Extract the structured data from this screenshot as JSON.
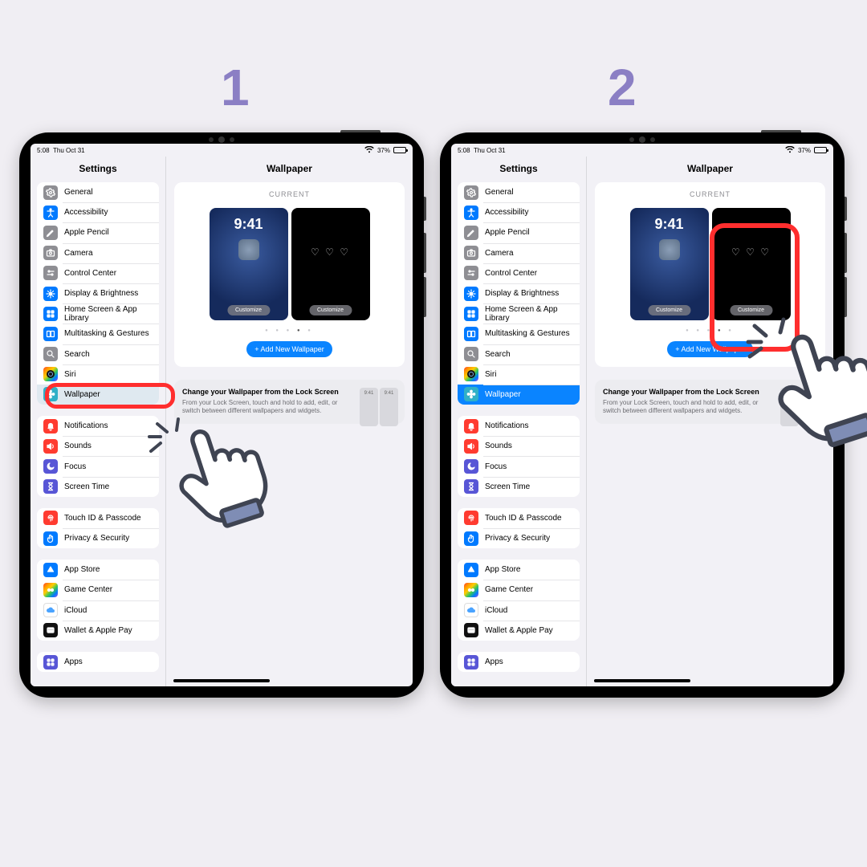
{
  "steps": [
    "1",
    "2"
  ],
  "status": {
    "time": "5:08",
    "date": "Thu Oct 31",
    "battery": "37%"
  },
  "sidebar_title": "Settings",
  "detail_title": "Wallpaper",
  "current_label": "CURRENT",
  "preview_time": "9:41",
  "customize": "Customize",
  "add_new": "+ Add New Wallpaper",
  "hint_title": "Change your Wallpaper from the Lock Screen",
  "hint_body": "From your Lock Screen, touch and hold to add, edit, or switch between different wallpapers and widgets.",
  "groups": [
    [
      {
        "label": "General",
        "icon": "gear",
        "cls": "bg-gray"
      },
      {
        "label": "Accessibility",
        "icon": "access",
        "cls": "bg-blue"
      },
      {
        "label": "Apple Pencil",
        "icon": "pencil",
        "cls": "bg-gray"
      },
      {
        "label": "Camera",
        "icon": "camera",
        "cls": "bg-gray"
      },
      {
        "label": "Control Center",
        "icon": "switches",
        "cls": "bg-gray"
      },
      {
        "label": "Display & Brightness",
        "icon": "sun",
        "cls": "bg-blue"
      },
      {
        "label": "Home Screen & App Library",
        "icon": "grid",
        "cls": "bg-blue"
      },
      {
        "label": "Multitasking & Gestures",
        "icon": "multi",
        "cls": "bg-blue"
      },
      {
        "label": "Search",
        "icon": "search",
        "cls": "bg-gray"
      },
      {
        "label": "Siri",
        "icon": "siri",
        "cls": "bg-rainbow"
      },
      {
        "label": "Wallpaper",
        "icon": "flower",
        "cls": "bg-teal",
        "selected": true
      }
    ],
    [
      {
        "label": "Notifications",
        "icon": "bell",
        "cls": "bg-red"
      },
      {
        "label": "Sounds",
        "icon": "speaker",
        "cls": "bg-red"
      },
      {
        "label": "Focus",
        "icon": "moon",
        "cls": "bg-indigo"
      },
      {
        "label": "Screen Time",
        "icon": "hourglass",
        "cls": "bg-indigo"
      }
    ],
    [
      {
        "label": "Touch ID & Passcode",
        "icon": "finger",
        "cls": "bg-red"
      },
      {
        "label": "Privacy & Security",
        "icon": "hand",
        "cls": "bg-blue"
      }
    ],
    [
      {
        "label": "App Store",
        "icon": "appstore",
        "cls": "bg-blue"
      },
      {
        "label": "Game Center",
        "icon": "game",
        "cls": "bg-rainbow"
      },
      {
        "label": "iCloud",
        "icon": "cloud",
        "cls": "bg-white"
      },
      {
        "label": "Wallet & Apple Pay",
        "icon": "wallet",
        "cls": "bg-black"
      }
    ],
    [
      {
        "label": "Apps",
        "icon": "apps",
        "cls": "bg-indigo"
      }
    ]
  ]
}
